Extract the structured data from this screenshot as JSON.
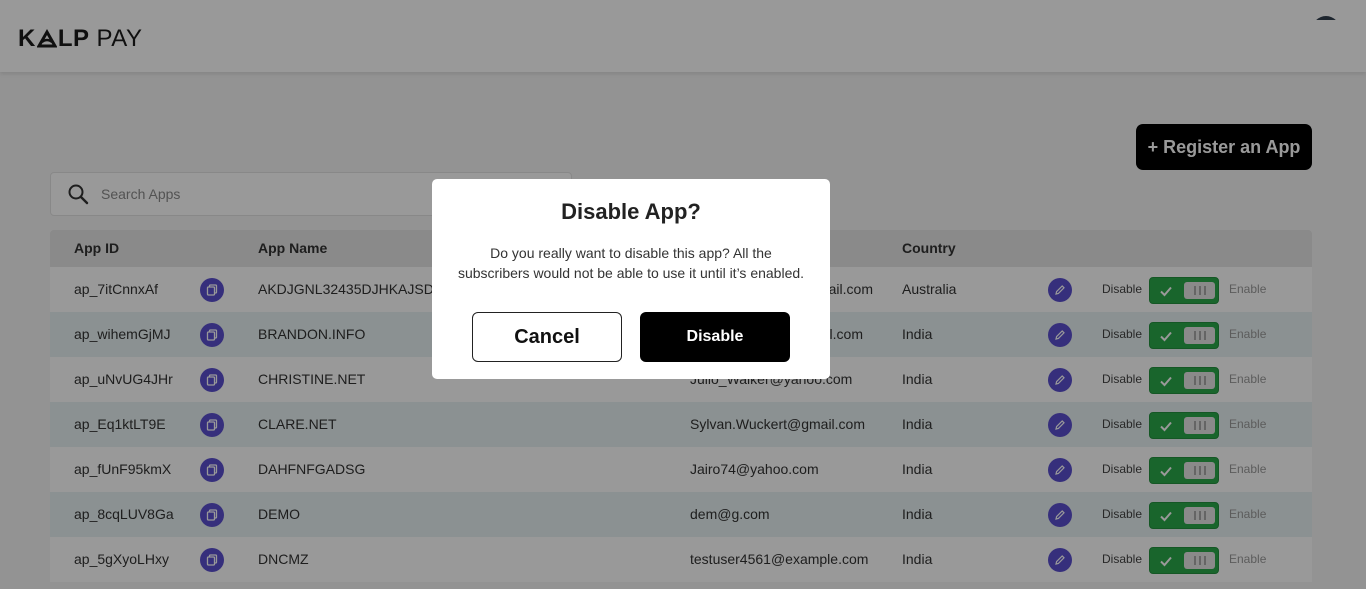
{
  "brand": {
    "part1": "K",
    "part2": "LP",
    "part3": "PAY"
  },
  "register_label": "+ Register an App",
  "search": {
    "placeholder": "Search Apps"
  },
  "table": {
    "headers": {
      "app_id": "App ID",
      "app_name": "App Name",
      "country": "Country"
    },
    "toggle_disable_label": "Disable",
    "toggle_enable_label": "Enable",
    "rows": [
      {
        "app_id": "ap_7itCnnxAf",
        "app_name": "AKDJGNL32435DJHKAJSDHSA",
        "email": "ail.com",
        "country": "Australia"
      },
      {
        "app_id": "ap_wihemGjMJ",
        "app_name": "BRANDON.INFO",
        "email": "l.com",
        "country": "India"
      },
      {
        "app_id": "ap_uNvUG4JHr",
        "app_name": "CHRISTINE.NET",
        "email": "Julio_Walker@yahoo.com",
        "country": "India"
      },
      {
        "app_id": "ap_Eq1ktLT9E",
        "app_name": "CLARE.NET",
        "email": "Sylvan.Wuckert@gmail.com",
        "country": "India"
      },
      {
        "app_id": "ap_fUnF95kmX",
        "app_name": "DAHFNFGADSG",
        "email": "Jairo74@yahoo.com",
        "country": "India"
      },
      {
        "app_id": "ap_8cqLUV8Ga",
        "app_name": "DEMO",
        "email": "dem@g.com",
        "country": "India"
      },
      {
        "app_id": "ap_5gXyoLHxy",
        "app_name": "DNCMZ",
        "email": "testuser4561@example.com",
        "country": "India"
      }
    ]
  },
  "modal": {
    "title": "Disable App?",
    "message": "Do you really want to disable this app? All the subscribers would not be able to use it until it’s enabled.",
    "cancel_label": "Cancel",
    "confirm_label": "Disable"
  },
  "colors": {
    "accent": "#5b4fcf",
    "toggle_on": "#2ba84a",
    "primary_button": "#000000"
  }
}
